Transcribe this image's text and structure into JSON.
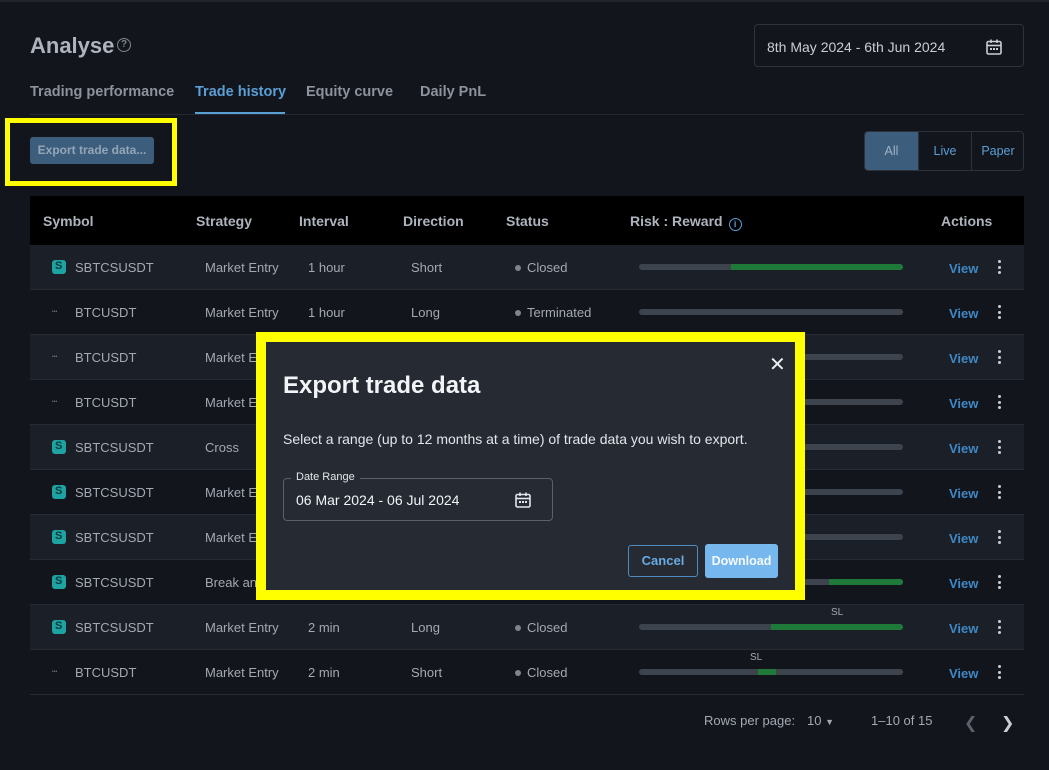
{
  "header": {
    "title": "Analyse",
    "help_icon": "?",
    "date_range": "8th May 2024 - 6th Jun 2024"
  },
  "tabs": [
    {
      "label": "Trading performance",
      "active": false
    },
    {
      "label": "Trade history",
      "active": true
    },
    {
      "label": "Equity curve",
      "active": false
    },
    {
      "label": "Daily PnL",
      "active": false
    }
  ],
  "toolbar": {
    "export_label": "Export trade data...",
    "filter": [
      {
        "label": "All",
        "active": true
      },
      {
        "label": "Live",
        "active": false
      },
      {
        "label": "Paper",
        "active": false
      }
    ]
  },
  "table": {
    "headers": {
      "symbol": "Symbol",
      "strategy": "Strategy",
      "interval": "Interval",
      "direction": "Direction",
      "status": "Status",
      "risk_reward": "Risk : Reward",
      "actions": "Actions"
    },
    "view_label": "View",
    "rows": [
      {
        "symbol": "SBTCSUSDT",
        "icon": "s-token-icon",
        "strategy": "Market Entry",
        "interval": "1 hour",
        "direction": "Short",
        "status": "Closed",
        "risk_fraction": 0.35,
        "reward_fraction": 0.65,
        "sl_label": ""
      },
      {
        "symbol": "BTCUSDT",
        "icon": "btc-token-icon",
        "strategy": "Market Entry",
        "interval": "1 hour",
        "direction": "Long",
        "status": "Terminated",
        "risk_fraction": 1.0,
        "reward_fraction": 0.0,
        "sl_label": ""
      },
      {
        "symbol": "BTCUSDT",
        "icon": "btc-token-icon",
        "strategy": "Market E",
        "interval": "",
        "direction": "",
        "status": "",
        "risk_fraction": 1.0,
        "reward_fraction": 0.0,
        "sl_label": ""
      },
      {
        "symbol": "BTCUSDT",
        "icon": "btc-token-icon",
        "strategy": "Market E",
        "interval": "",
        "direction": "",
        "status": "",
        "risk_fraction": 1.0,
        "reward_fraction": 0.0,
        "sl_label": ""
      },
      {
        "symbol": "SBTCSUSDT",
        "icon": "s-token-icon",
        "strategy": "Cross",
        "interval": "",
        "direction": "",
        "status": "",
        "risk_fraction": 1.0,
        "reward_fraction": 0.0,
        "sl_label": ""
      },
      {
        "symbol": "SBTCSUSDT",
        "icon": "s-token-icon",
        "strategy": "Market E",
        "interval": "",
        "direction": "",
        "status": "",
        "risk_fraction": 1.0,
        "reward_fraction": 0.0,
        "sl_label": ""
      },
      {
        "symbol": "SBTCSUSDT",
        "icon": "s-token-icon",
        "strategy": "Market E",
        "interval": "",
        "direction": "",
        "status": "",
        "risk_fraction": 1.0,
        "reward_fraction": 0.0,
        "sl_label": ""
      },
      {
        "symbol": "SBTCSUSDT",
        "icon": "s-token-icon",
        "strategy": "Break an",
        "interval": "",
        "direction": "",
        "status": "",
        "risk_fraction": 0.72,
        "reward_fraction": 0.28,
        "sl_label": ""
      },
      {
        "symbol": "SBTCSUSDT",
        "icon": "s-token-icon",
        "strategy": "Market Entry",
        "interval": "2 min",
        "direction": "Long",
        "status": "Closed",
        "risk_fraction": 0.5,
        "reward_fraction": 0.5,
        "sl_label": "SL"
      },
      {
        "symbol": "BTCUSDT",
        "icon": "btc-token-icon",
        "strategy": "Market Entry",
        "interval": "2 min",
        "direction": "Short",
        "status": "Closed",
        "risk_fraction": 0.45,
        "reward_fraction": 0.07,
        "sl_label": "SL"
      }
    ]
  },
  "pagination": {
    "rows_per_page_label": "Rows per page:",
    "rows_per_page": "10",
    "range": "1–10 of 15"
  },
  "modal": {
    "title": "Export trade data",
    "description": "Select a range (up to 12 months at a time) of trade data you wish to export.",
    "field_label": "Date Range",
    "field_value": "06 Mar 2024 - 06 Jul 2024",
    "cancel_label": "Cancel",
    "download_label": "Download"
  },
  "colors": {
    "accent": "#5a9fd6",
    "highlight": "#ffff00",
    "reward_bar": "#1f7a3a",
    "risk_bar": "#3e444e"
  }
}
